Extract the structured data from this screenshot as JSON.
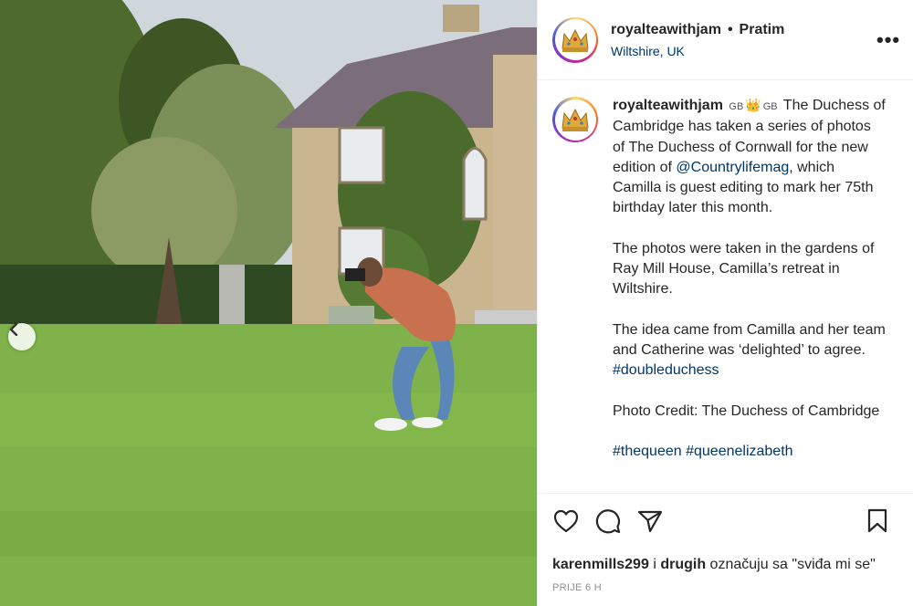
{
  "header": {
    "username": "royalteawithjam",
    "separator": "•",
    "follow_label": "Pratim",
    "location": "Wiltshire, UK",
    "more_label": "•••"
  },
  "caption": {
    "username": "royalteawithjam",
    "flag1": "GB",
    "crown": "👑",
    "flag2": "GB",
    "para1_text": "The Duchess of Cambridge has taken a series of photos of The Duchess of Cornwall for the new edition of",
    "para1_mention": "@Countrylifemag",
    "para1_rest": ", which Camilla is guest editing to mark her 75th birthday later this month.",
    "para2": "The photos were taken in the gardens of Ray Mill House, Camilla’s retreat in Wiltshire.",
    "para3_text": "The idea came from Camilla and her team and Catherine was ‘delighted’ to agree.",
    "para3_tag": "#doubleduchess",
    "para4": "Photo Credit: The Duchess of Cambridge",
    "tag1": "#thequeen",
    "tag2": "#queenelizabeth"
  },
  "likes": {
    "user": "karenmills299",
    "and": "i",
    "others": "drugih",
    "suffix": "označuju sa \"sviđa mi se\""
  },
  "time": "PRIJE 6 H",
  "icons": {
    "like": "heart-icon",
    "comment": "comment-icon",
    "share": "paper-plane-icon",
    "save": "bookmark-icon",
    "prev": "chevron-left-icon"
  },
  "colors": {
    "link": "#00376b",
    "text": "#262626",
    "muted": "#8e8e8e",
    "grass": "#7fb24a"
  }
}
